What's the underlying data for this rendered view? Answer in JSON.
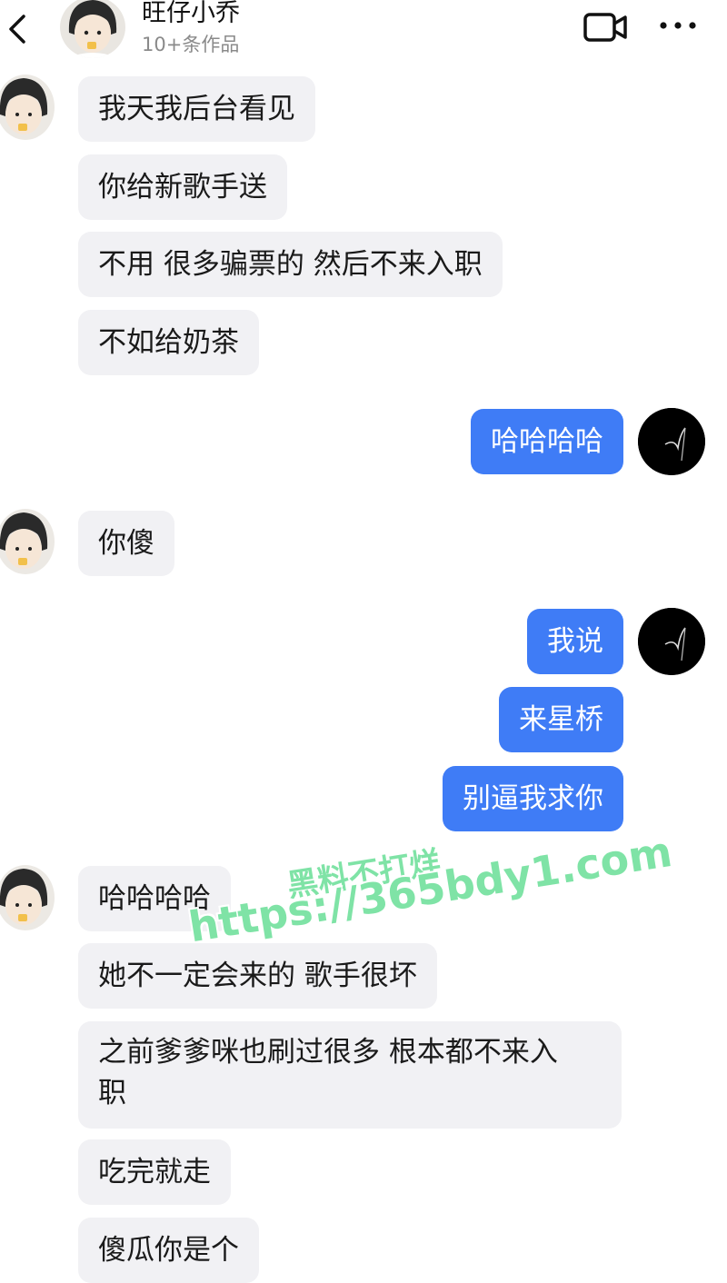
{
  "header": {
    "name": "旺仔小乔",
    "subtitle": "10+条作品",
    "icons": [
      "chevron-left-icon",
      "video-camera-icon",
      "more-dots-icon"
    ]
  },
  "messages": [
    {
      "side": "in",
      "text": "我天我后台看见"
    },
    {
      "side": "in",
      "text": "你给新歌手送"
    },
    {
      "side": "in",
      "text": "不用 很多骗票的 然后不来入职"
    },
    {
      "side": "in",
      "text": "不如给奶茶"
    },
    {
      "side": "out",
      "text": "哈哈哈哈"
    },
    {
      "side": "in",
      "text": "你傻"
    },
    {
      "side": "out",
      "text": "我说"
    },
    {
      "side": "out",
      "text": "来星桥"
    },
    {
      "side": "out",
      "text": "别逼我求你"
    },
    {
      "side": "in",
      "text": "哈哈哈哈"
    },
    {
      "side": "in",
      "text": "她不一定会来的 歌手很坏"
    },
    {
      "side": "in",
      "line1": "之前爹爹咪也刷过很多 根本都不来入",
      "line2": "职"
    },
    {
      "side": "in",
      "text": "吃完就走"
    },
    {
      "side": "in",
      "text": "傻瓜你是个"
    }
  ],
  "watermark": {
    "line1": "黑料不打烊",
    "line2": "https://365bdy1.com"
  },
  "colors": {
    "outgoing_bubble": "#3f7cf6",
    "incoming_bubble": "#f1f1f4",
    "watermark": "#7fe3a6"
  }
}
